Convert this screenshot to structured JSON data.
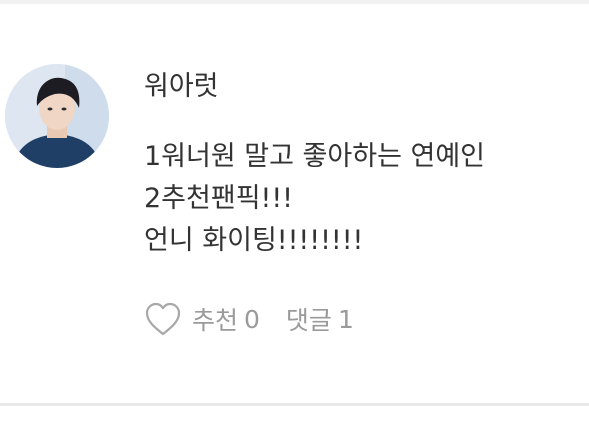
{
  "comment": {
    "author": "워아럿",
    "lines": [
      "1워너원 말고 좋아하는 연예인",
      "2추천팬픽!!!",
      "언니 화이팅!!!!!!!!"
    ],
    "like_label": "추천",
    "like_count": "0",
    "reply_label": "댓글",
    "reply_count": "1"
  },
  "icons": {
    "like": "heart-outline-icon"
  }
}
